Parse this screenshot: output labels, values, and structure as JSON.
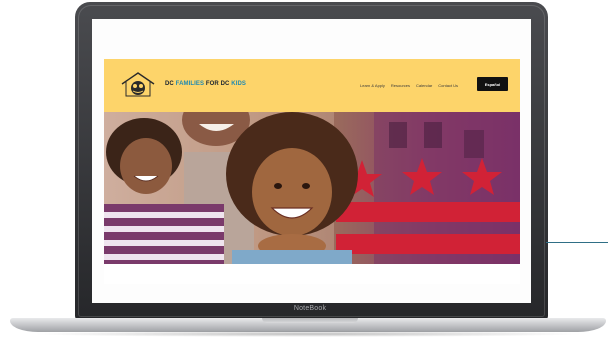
{
  "device": {
    "brand_label": "NoteBook"
  },
  "site": {
    "title_part1": "DC ",
    "title_part2": "FAMILIES ",
    "title_part3": "FOR DC ",
    "title_part4": "KIDS",
    "nav": {
      "links": [
        "Learn & Apply",
        "Resources",
        "Calendar",
        "Contact Us"
      ],
      "language_button": "Español"
    }
  },
  "colors": {
    "header_bg": "#fdd46a",
    "title_dark": "#1b2430",
    "title_teal": "#1f8ab3",
    "flag_red": "#d12236",
    "pointer_line": "#2f6f86"
  },
  "icons": {
    "chat": "chat-bubble-icon",
    "logo": "family-house-logo"
  }
}
